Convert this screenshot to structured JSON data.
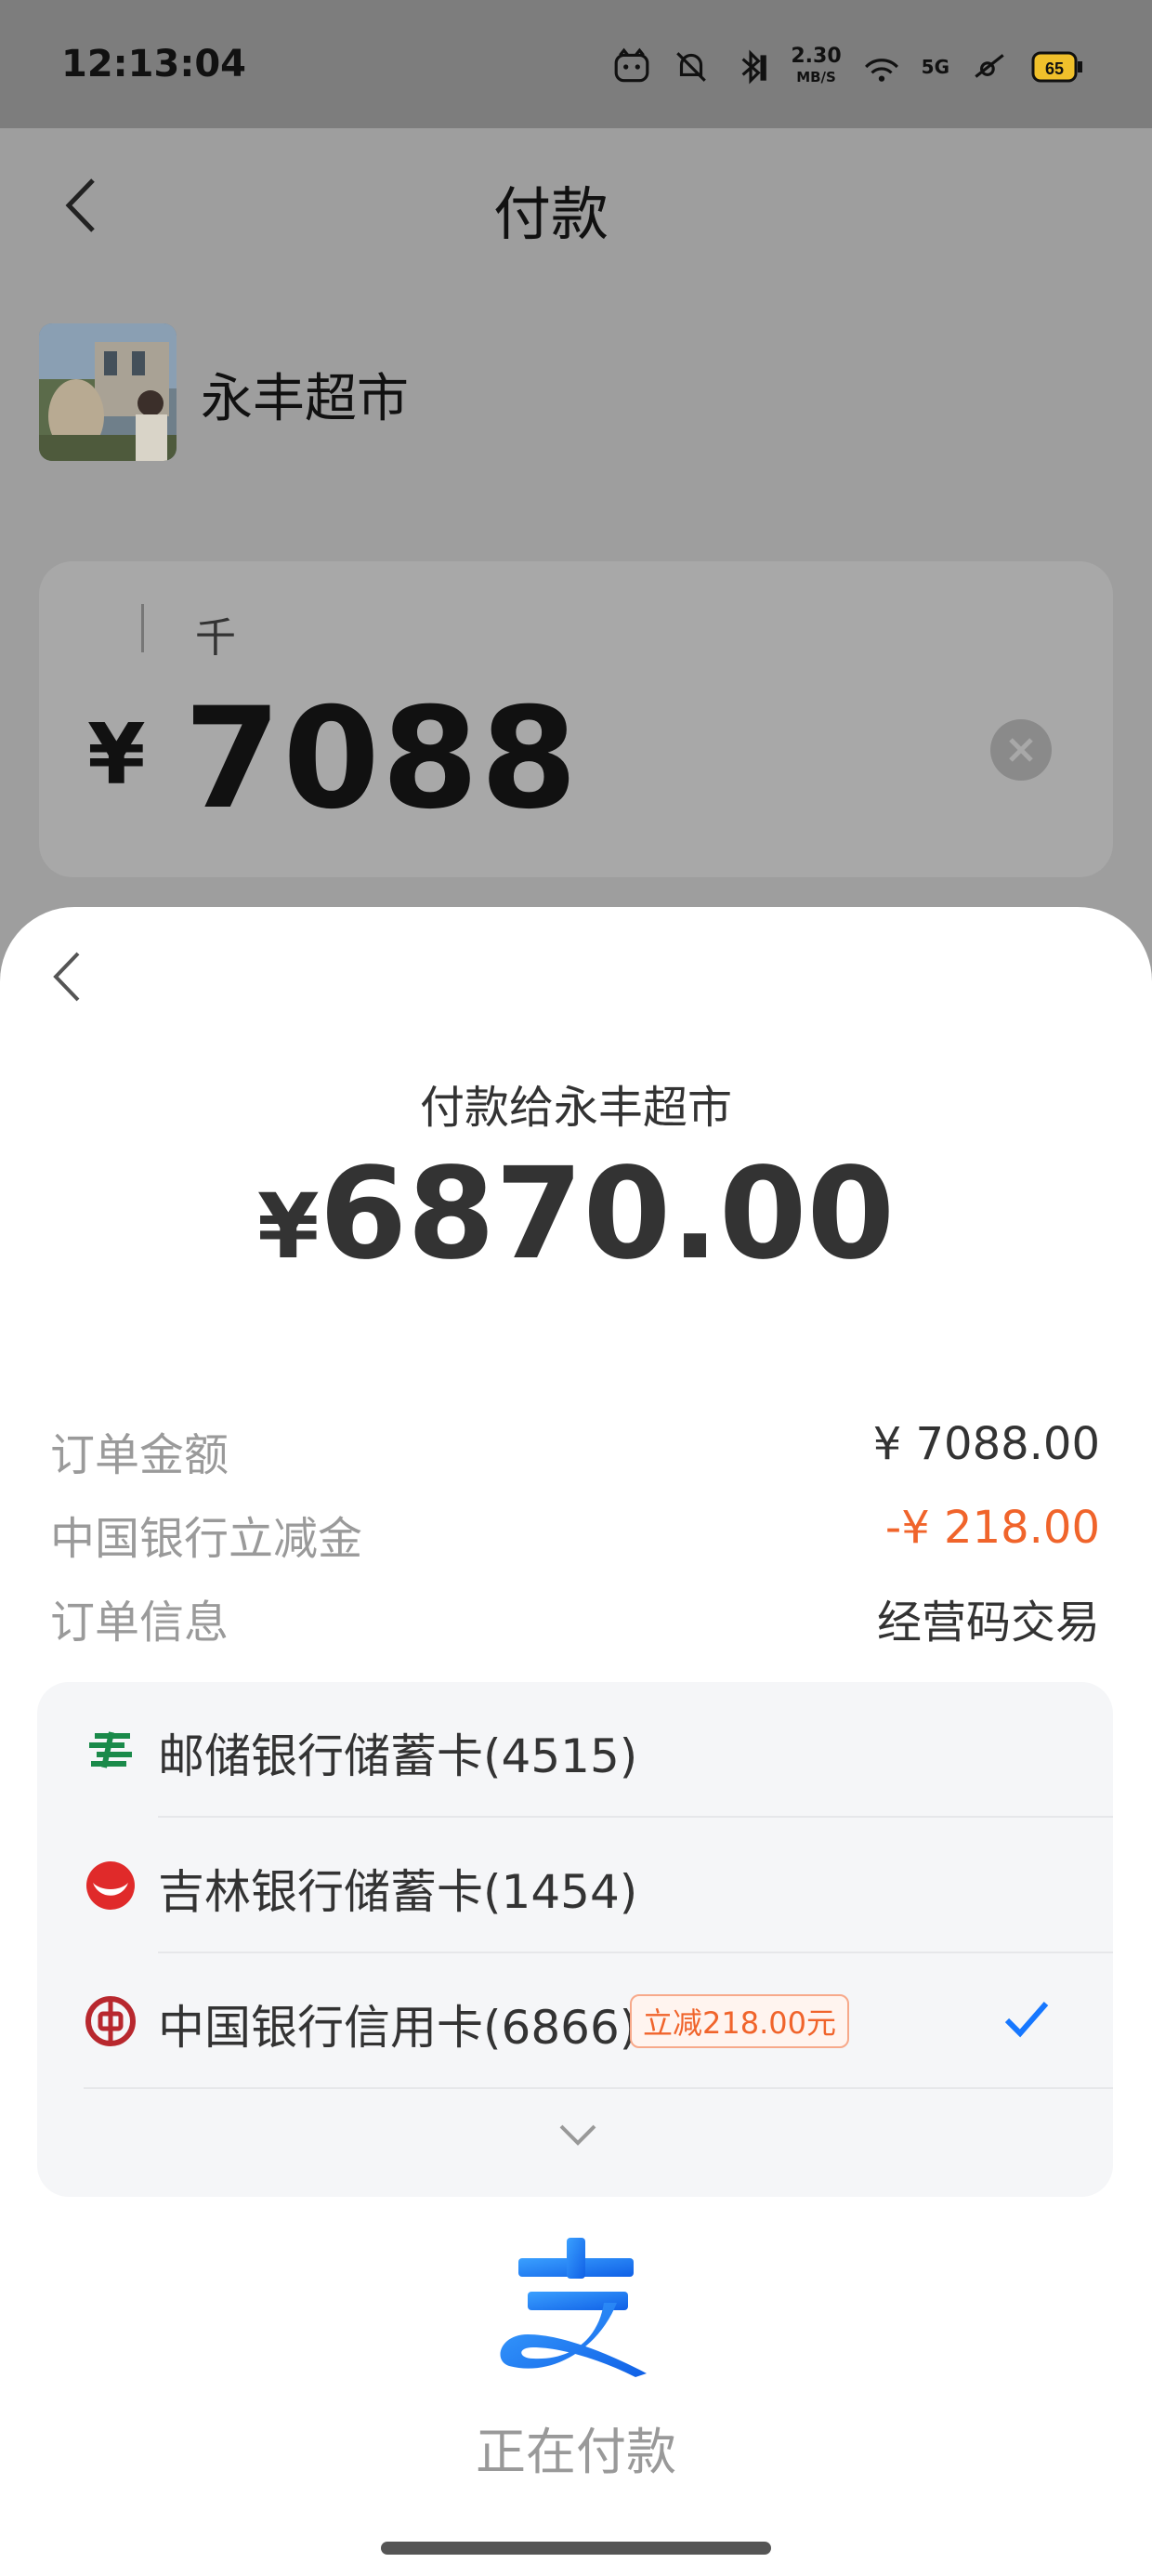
{
  "status_bar": {
    "time": "12:13:04",
    "net_speed_value": "2.30",
    "net_speed_unit": "MB/S",
    "signal_label": "5G",
    "battery": "65"
  },
  "page": {
    "title": "付款",
    "merchant_name": "永丰超市",
    "amount_unit_hint": "千",
    "amount_currency": "¥",
    "amount_input": "7088"
  },
  "sheet": {
    "payee_label": "付款给永丰超市",
    "pay_currency": "¥",
    "pay_amount": "6870.00",
    "details": [
      {
        "label": "订单金额",
        "value": "¥ 7088.00"
      },
      {
        "label": "中国银行立减金",
        "value": "-¥ 218.00"
      },
      {
        "label": "订单信息",
        "value": "经营码交易"
      }
    ],
    "cards": [
      {
        "name": "邮储银行储蓄卡(4515)",
        "icon": "psbc-bank-icon"
      },
      {
        "name": "吉林银行储蓄卡(1454)",
        "icon": "jilin-bank-icon"
      },
      {
        "name": "中国银行信用卡(6866)",
        "icon": "boc-bank-icon",
        "promo": "立减218.00元",
        "selected": true
      }
    ],
    "processing_text": "正在付款"
  },
  "colors": {
    "accent_orange": "#f0642b",
    "check_blue": "#1677ff",
    "alipay_blue": "#1677ff"
  }
}
